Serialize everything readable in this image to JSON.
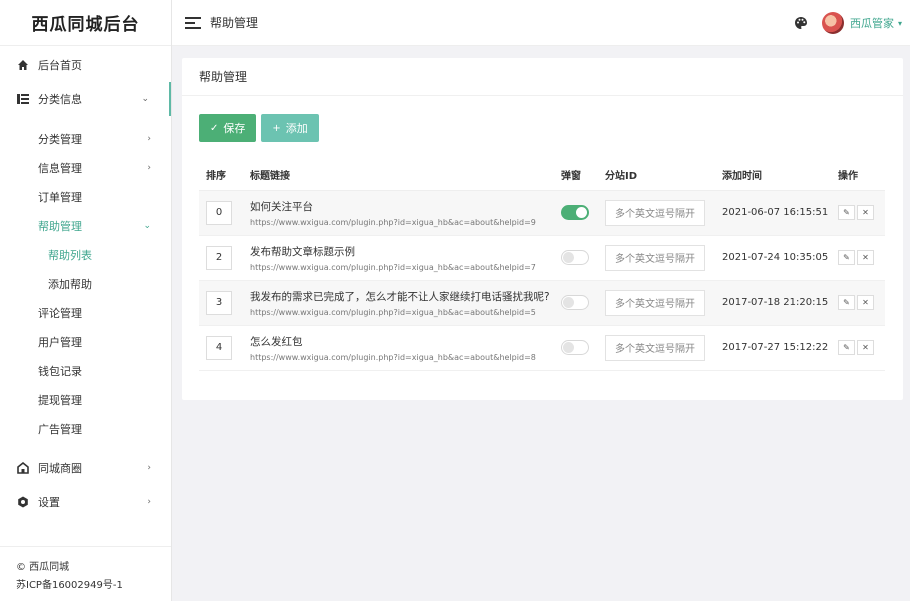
{
  "logo": "西瓜同城后台",
  "header": {
    "title": "帮助管理",
    "user_name": "西瓜管家",
    "user_caret": "▾"
  },
  "sidebar": {
    "home": "后台首页",
    "classify": "分类信息",
    "classify_sub": {
      "category": "分类管理",
      "info": "信息管理",
      "order": "订单管理",
      "help": "帮助管理",
      "help_list": "帮助列表",
      "help_add": "添加帮助",
      "comment": "评论管理",
      "user": "用户管理",
      "wallet": "钱包记录",
      "withdraw": "提现管理",
      "ad": "广告管理"
    },
    "shop": "同城商圈",
    "settings": "设置",
    "footer": {
      "copyright": "© 西瓜同城",
      "icp": "苏ICP备16002949号-1"
    }
  },
  "card": {
    "title": "帮助管理",
    "save_label": "保存",
    "add_label": "添加",
    "save_icon": "✓",
    "add_icon": "+",
    "columns": [
      "排序",
      "标题链接",
      "弹窗",
      "分站ID",
      "添加时间",
      "操作"
    ],
    "site_placeholder": "多个英文逗号隔开",
    "rows": [
      {
        "sort": "0",
        "title": "如何关注平台",
        "url": "https://www.wxigua.com/plugin.php?id=xigua_hb&ac=about&helpid=9",
        "popup": true,
        "time": "2021-06-07 16:15:51"
      },
      {
        "sort": "2",
        "title": "发布帮助文章标题示例",
        "url": "https://www.wxigua.com/plugin.php?id=xigua_hb&ac=about&helpid=7",
        "popup": false,
        "time": "2021-07-24 10:35:05"
      },
      {
        "sort": "3",
        "title": "我发布的需求已完成了，怎么才能不让人家继续打电话骚扰我呢?",
        "url": "https://www.wxigua.com/plugin.php?id=xigua_hb&ac=about&helpid=5",
        "popup": false,
        "time": "2017-07-18 21:20:15"
      },
      {
        "sort": "4",
        "title": "怎么发红包",
        "url": "https://www.wxigua.com/plugin.php?id=xigua_hb&ac=about&helpid=8",
        "popup": false,
        "time": "2017-07-27 15:12:22"
      }
    ]
  },
  "colors": {
    "accent": "#3fa68e",
    "save": "#4caf76",
    "add": "#6cc3b1"
  }
}
